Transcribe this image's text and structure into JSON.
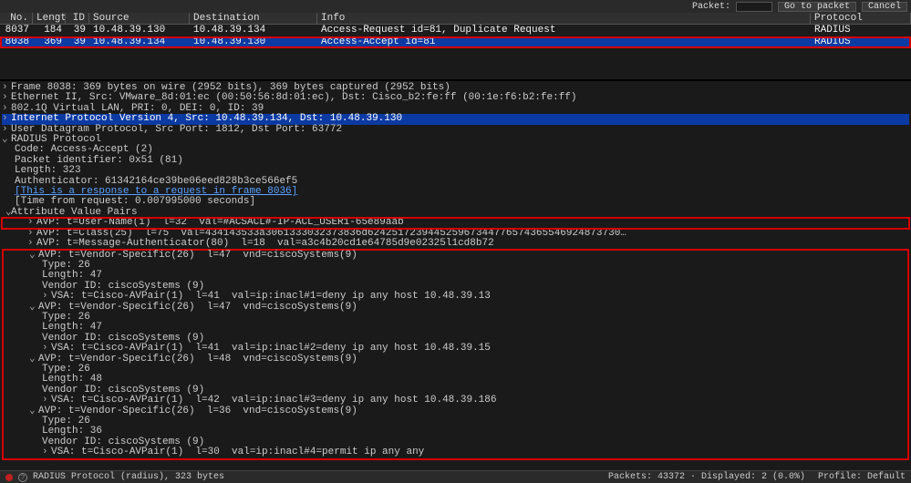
{
  "topbar": {
    "packet_label": "Packet:",
    "packet_value": "",
    "go_btn": "Go to packet",
    "cancel_btn": "Cancel"
  },
  "columns": {
    "no": "No.",
    "len": "Length",
    "id": "ID",
    "src": "Source",
    "dst": "Destination",
    "info": "Info",
    "proto": "Protocol"
  },
  "rows": [
    {
      "no": "8037",
      "len": "184",
      "id": "39",
      "src": "10.48.39.130",
      "dst": "10.48.39.134",
      "info": "Access-Request id=81, Duplicate Request",
      "proto": "RADIUS",
      "sel": false
    },
    {
      "no": "8038",
      "len": "369",
      "id": "39",
      "src": "10.48.39.134",
      "dst": "10.48.39.130",
      "info": "Access-Accept id=81",
      "proto": "RADIUS",
      "sel": true
    }
  ],
  "tree": {
    "frame": "Frame 8038: 369 bytes on wire (2952 bits), 369 bytes captured (2952 bits)",
    "eth": "Ethernet II, Src: VMware_8d:01:ec (00:50:56:8d:01:ec), Dst: Cisco_b2:fe:ff (00:1e:f6:b2:fe:ff)",
    "vlan": "802.1Q Virtual LAN, PRI: 0, DEI: 0, ID: 39",
    "ip": "Internet Protocol Version 4, Src: 10.48.39.134, Dst: 10.48.39.130",
    "udp": "User Datagram Protocol, Src Port: 1812, Dst Port: 63772",
    "radius": "RADIUS Protocol",
    "code": "Code: Access-Accept (2)",
    "pid": "Packet identifier: 0x51 (81)",
    "len": "Length: 323",
    "auth": "Authenticator: 61342164ce39be06eed828b3ce566ef5",
    "resp_link": "[This is a response to a request in frame 8036]",
    "time": "[Time from request: 0.007995000 seconds]",
    "avp_hdr": "Attribute Value Pairs",
    "avp_user": "AVP: t=User-Name(1)  l=32  val=#ACSACL#-IP-ACL_USER1-65e89aab",
    "avp_class": "AVP: t=Class(25)  l=75  val=434143533a3061333032373836d624251723944525967344776574365546924873730…",
    "avp_msgauth": "AVP: t=Message-Authenticator(80)  l=18  val=a3c4b20cd1e64785d9e02325l1cd8b72",
    "vs1": {
      "head": "AVP: t=Vendor-Specific(26)  l=47  vnd=ciscoSystems(9)",
      "type": "Type: 26",
      "len": "Length: 47",
      "vid": "Vendor ID: ciscoSystems (9)",
      "vsa": "VSA: t=Cisco-AVPair(1)  l=41  val=ip:inacl#1=deny ip any host 10.48.39.13"
    },
    "vs2": {
      "head": "AVP: t=Vendor-Specific(26)  l=47  vnd=ciscoSystems(9)",
      "type": "Type: 26",
      "len": "Length: 47",
      "vid": "Vendor ID: ciscoSystems (9)",
      "vsa": "VSA: t=Cisco-AVPair(1)  l=41  val=ip:inacl#2=deny ip any host 10.48.39.15"
    },
    "vs3": {
      "head": "AVP: t=Vendor-Specific(26)  l=48  vnd=ciscoSystems(9)",
      "type": "Type: 26",
      "len": "Length: 48",
      "vid": "Vendor ID: ciscoSystems (9)",
      "vsa": "VSA: t=Cisco-AVPair(1)  l=42  val=ip:inacl#3=deny ip any host 10.48.39.186"
    },
    "vs4": {
      "head": "AVP: t=Vendor-Specific(26)  l=36  vnd=ciscoSystems(9)",
      "type": "Type: 26",
      "len": "Length: 36",
      "vid": "Vendor ID: ciscoSystems (9)",
      "vsa": "VSA: t=Cisco-AVPair(1)  l=30  val=ip:inacl#4=permit ip any any"
    }
  },
  "status": {
    "left": "RADIUS Protocol (radius), 323 bytes",
    "pkts": "Packets: 43372 · Displayed: 2 (0.0%)",
    "profile": "Profile: Default"
  }
}
